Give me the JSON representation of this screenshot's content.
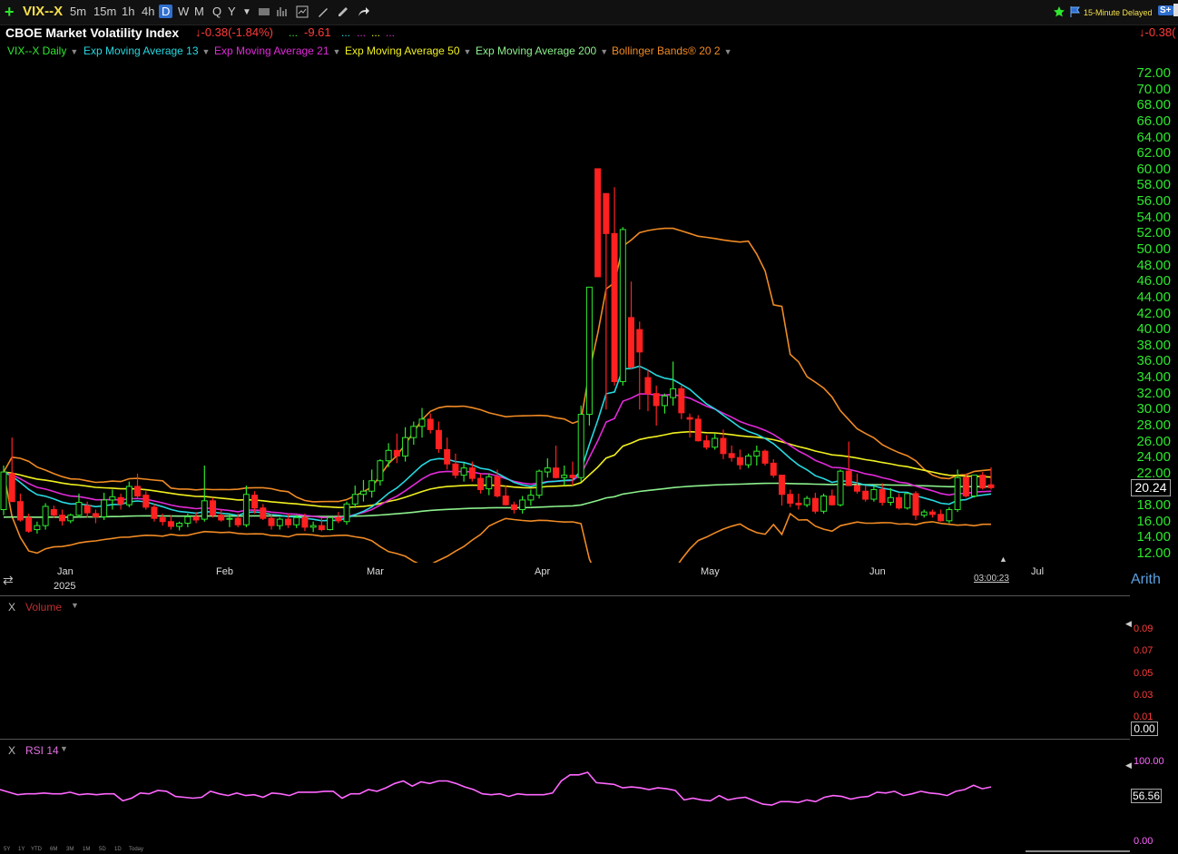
{
  "toolbar": {
    "symbol": "VIX--X",
    "intervals": [
      "5m",
      "15m",
      "1h",
      "4h",
      "D",
      "W",
      "M",
      "Q",
      "Y"
    ],
    "selected_interval": "D",
    "delayed_label": "15-Minute Delayed",
    "right_change": "-0.38("
  },
  "header": {
    "title": "CBOE Market Volatility Index",
    "change": "-0.38(-1.84%)",
    "change2": "-9.61"
  },
  "legend": [
    {
      "label": "VIX--X Daily",
      "color": "#2ee82e"
    },
    {
      "label": "Exp Moving Average 13",
      "color": "#27d8e0"
    },
    {
      "label": "Exp Moving Average 21",
      "color": "#e02ad8"
    },
    {
      "label": "Exp Moving Average 50",
      "color": "#f0f020"
    },
    {
      "label": "Exp Moving Average 200",
      "color": "#8cf08c"
    },
    {
      "label": "Bollinger Bands® 20 2",
      "color": "#f08a24"
    }
  ],
  "price_axis": [
    "72.00",
    "70.00",
    "68.00",
    "66.00",
    "64.00",
    "62.00",
    "60.00",
    "58.00",
    "56.00",
    "54.00",
    "52.00",
    "50.00",
    "48.00",
    "46.00",
    "44.00",
    "42.00",
    "40.00",
    "38.00",
    "36.00",
    "34.00",
    "32.00",
    "30.00",
    "28.00",
    "26.00",
    "24.00",
    "22.00",
    "20.00",
    "18.00",
    "16.00",
    "14.00",
    "12.00"
  ],
  "current_price": "20.24",
  "months": [
    "Jan",
    "2025",
    "Feb",
    "Mar",
    "Apr",
    "May",
    "Jun",
    "Jul"
  ],
  "scale_mode": "Arith",
  "clock": "03:00:23",
  "volume_pane": {
    "title": "Volume",
    "axis": [
      "0.09",
      "0.07",
      "0.05",
      "0.03",
      "0.01"
    ],
    "value": "0.00"
  },
  "rsi_pane": {
    "title": "RSI 14",
    "axis_top": "100.00",
    "axis_bottom": "0.00",
    "value": "56.56",
    "values": [
      60,
      57,
      54,
      55,
      55,
      56,
      55,
      55,
      57,
      54,
      55,
      54,
      55,
      55,
      47,
      50,
      56,
      55,
      59,
      58,
      52,
      51,
      50,
      51,
      58,
      55,
      53,
      56,
      53,
      54,
      51,
      56,
      55,
      53,
      57,
      57,
      57,
      58,
      58,
      50,
      55,
      55,
      60,
      58,
      62,
      67,
      70,
      64,
      69,
      67,
      70,
      70,
      67,
      63,
      60,
      55,
      54,
      55,
      52,
      55,
      54,
      54,
      54,
      56,
      70,
      77,
      77,
      80,
      68,
      67,
      66,
      62,
      63,
      62,
      60,
      62,
      61,
      59,
      48,
      50,
      48,
      47,
      53,
      48,
      50,
      51,
      47,
      43,
      42,
      46,
      46,
      45,
      48,
      46,
      51,
      53,
      52,
      49,
      51,
      52,
      57,
      56,
      58,
      53,
      55,
      58,
      56,
      55,
      53,
      58,
      60,
      65,
      61,
      63
    ],
    "dates_hint": []
  },
  "bottom_ranges": [
    "5Y",
    "1Y",
    "YTD",
    "6M",
    "3M",
    "1M",
    "5D",
    "1D",
    "Today"
  ],
  "chart_data": {
    "type": "candlestick",
    "title": "CBOE Market Volatility Index",
    "ylim": [
      12,
      72
    ],
    "ohlc": [
      [
        17.5,
        23,
        16.8,
        22.2
      ],
      [
        22,
        26.5,
        19,
        18.5
      ],
      [
        18.5,
        19.5,
        16,
        16.2
      ],
      [
        16.5,
        17,
        14.6,
        14.8
      ],
      [
        15,
        16,
        14.5,
        15.5
      ],
      [
        15.5,
        18.3,
        15,
        17.9
      ],
      [
        17.5,
        18,
        16.5,
        16.8
      ],
      [
        16.8,
        17.5,
        15.5,
        16.1
      ],
      [
        16.1,
        17,
        15.8,
        16.8
      ],
      [
        16.8,
        19.5,
        16.5,
        18.4
      ],
      [
        18,
        18.5,
        16.5,
        17.1
      ],
      [
        17,
        17.5,
        15.8,
        16.6
      ],
      [
        16.6,
        19.6,
        16.2,
        18.7
      ],
      [
        18.7,
        20,
        17.5,
        19.1
      ],
      [
        19,
        19.5,
        17.5,
        18.2
      ],
      [
        18.1,
        21,
        17.8,
        20.4
      ],
      [
        20.4,
        22,
        19,
        19.2
      ],
      [
        19.3,
        19.8,
        17.5,
        17.8
      ],
      [
        17.8,
        18.2,
        16,
        16.4
      ],
      [
        16.5,
        17,
        15.5,
        16
      ],
      [
        16,
        16.8,
        15,
        15.4
      ],
      [
        15.4,
        16,
        14.9,
        15.8
      ],
      [
        15.8,
        17,
        15.3,
        16.6
      ],
      [
        16.6,
        17.2,
        15.8,
        16.2
      ],
      [
        16.3,
        23,
        16,
        18.6
      ],
      [
        18.6,
        19,
        16.5,
        16.8
      ],
      [
        16.8,
        17.5,
        16,
        16.2
      ],
      [
        16.3,
        17,
        15.3,
        16.4
      ],
      [
        16.4,
        17,
        15.3,
        15.6
      ],
      [
        15.6,
        20.5,
        15.3,
        19.4
      ],
      [
        19.3,
        19.8,
        17,
        17.7
      ],
      [
        17.7,
        18.2,
        16.2,
        16.4
      ],
      [
        16.4,
        17,
        15,
        15.5
      ],
      [
        15.5,
        16.5,
        15,
        16.3
      ],
      [
        16.3,
        17,
        15.2,
        15.6
      ],
      [
        15.6,
        16.8,
        15.2,
        16.5
      ],
      [
        16.5,
        17,
        14.8,
        15.3
      ],
      [
        15.3,
        16,
        14.7,
        15.5
      ],
      [
        15.5,
        16.5,
        14.8,
        15
      ],
      [
        15,
        16.6,
        14.9,
        16.5
      ],
      [
        16.5,
        17.2,
        15.8,
        16.1
      ],
      [
        16,
        18.5,
        15.6,
        18.2
      ],
      [
        18.2,
        20.5,
        17.7,
        19.4
      ],
      [
        19.4,
        21.2,
        18.5,
        19.8
      ],
      [
        19.8,
        22.5,
        19,
        21.1
      ],
      [
        21.1,
        23.8,
        20.5,
        23.6
      ],
      [
        23.6,
        25.8,
        22.8,
        24.9
      ],
      [
        24.9,
        27,
        23.3,
        24.2
      ],
      [
        24.2,
        27.8,
        23.5,
        26.5
      ],
      [
        26.5,
        28.5,
        25.6,
        27.9
      ],
      [
        27.9,
        30.2,
        26.5,
        28.8
      ],
      [
        28.8,
        29.5,
        27,
        27.5
      ],
      [
        27.4,
        28.5,
        24.6,
        25.1
      ],
      [
        25,
        26.5,
        22.5,
        23.2
      ],
      [
        23.2,
        24.5,
        21.4,
        21.8
      ],
      [
        21.8,
        23.3,
        21,
        22.7
      ],
      [
        22.7,
        23.5,
        21,
        21.4
      ],
      [
        21.4,
        22,
        19.5,
        20
      ],
      [
        20.1,
        22,
        19.3,
        21.6
      ],
      [
        21.6,
        22.5,
        19,
        19.2
      ],
      [
        19.2,
        20.5,
        18,
        18.1
      ],
      [
        18.1,
        18.5,
        17,
        17.5
      ],
      [
        17.5,
        19.2,
        17,
        18.7
      ],
      [
        18.7,
        20,
        18,
        19.3
      ],
      [
        19.3,
        22.5,
        18.9,
        22.3
      ],
      [
        22.2,
        23.9,
        21.5,
        22.7
      ],
      [
        22.7,
        25.5,
        21.4,
        21.5
      ],
      [
        21.5,
        23,
        20.5,
        21.8
      ],
      [
        21.8,
        23.5,
        20.5,
        21.5
      ],
      [
        21.5,
        30.5,
        21,
        29.4
      ],
      [
        29.4,
        45.3,
        28,
        45.3
      ],
      [
        60.1,
        60.1,
        46.8,
        46.6
      ],
      [
        57,
        57,
        30,
        52
      ],
      [
        52,
        57.8,
        33,
        33.5
      ],
      [
        33.5,
        52.8,
        33,
        52.5
      ],
      [
        41.5,
        46,
        35,
        35.3
      ],
      [
        40,
        41,
        30,
        37.2
      ],
      [
        34,
        35,
        29.8,
        32
      ],
      [
        32,
        33,
        28,
        30.5
      ],
      [
        30.5,
        32,
        29.5,
        31.7
      ],
      [
        31.5,
        36,
        30.5,
        32.6
      ],
      [
        32.6,
        33,
        28.8,
        29.6
      ],
      [
        29,
        29.5,
        26.5,
        28.8
      ],
      [
        28.8,
        29.3,
        26,
        26.1
      ],
      [
        26.1,
        26.8,
        25,
        25.3
      ],
      [
        25.3,
        27,
        25,
        26.4
      ],
      [
        26.4,
        27.5,
        23.8,
        24.5
      ],
      [
        24.5,
        25.5,
        23.5,
        24
      ],
      [
        24,
        25,
        22.5,
        23.1
      ],
      [
        23.1,
        24.5,
        22.7,
        24.2
      ],
      [
        24.2,
        25.5,
        23,
        24.8
      ],
      [
        24.8,
        25,
        23,
        23.3
      ],
      [
        23.3,
        23.8,
        21.5,
        21.8
      ],
      [
        21.8,
        21.8,
        18,
        19.4
      ],
      [
        19.4,
        20,
        17.8,
        18.3
      ],
      [
        18.3,
        19.5,
        17.5,
        18.1
      ],
      [
        18.1,
        19.2,
        17.8,
        18.9
      ],
      [
        18.9,
        19.6,
        17,
        17.3
      ],
      [
        17.3,
        19.5,
        17,
        19.2
      ],
      [
        19.2,
        20,
        18,
        18.1
      ],
      [
        18.1,
        22.5,
        17.9,
        22.3
      ],
      [
        22.3,
        26,
        20.5,
        20.5
      ],
      [
        20.5,
        22,
        19.5,
        19.8
      ],
      [
        19.8,
        20.5,
        18.5,
        18.8
      ],
      [
        18.8,
        20.5,
        18.5,
        20
      ],
      [
        20,
        20.8,
        18,
        18.4
      ],
      [
        18.4,
        20.2,
        18,
        19
      ],
      [
        19,
        19.5,
        17.5,
        17.7
      ],
      [
        17.7,
        19.5,
        17.5,
        19.5
      ],
      [
        19.5,
        19.8,
        16.2,
        16.8
      ],
      [
        16.8,
        17.5,
        16.5,
        17.2
      ],
      [
        17.2,
        17.5,
        16.5,
        16.9
      ],
      [
        16.9,
        17.5,
        16,
        16.1
      ],
      [
        16.1,
        17.8,
        15.8,
        17.5
      ],
      [
        17.5,
        22.5,
        17.2,
        21.5
      ],
      [
        21.5,
        22,
        19,
        19.2
      ],
      [
        19.2,
        21.8,
        19,
        21.8
      ],
      [
        21.8,
        22.2,
        20,
        20.2
      ],
      [
        20.6,
        22.8,
        20,
        20.24
      ]
    ],
    "ema13_note": "overlay lines: EMA13, EMA21, EMA50, EMA200, Bollinger upper/lower"
  }
}
